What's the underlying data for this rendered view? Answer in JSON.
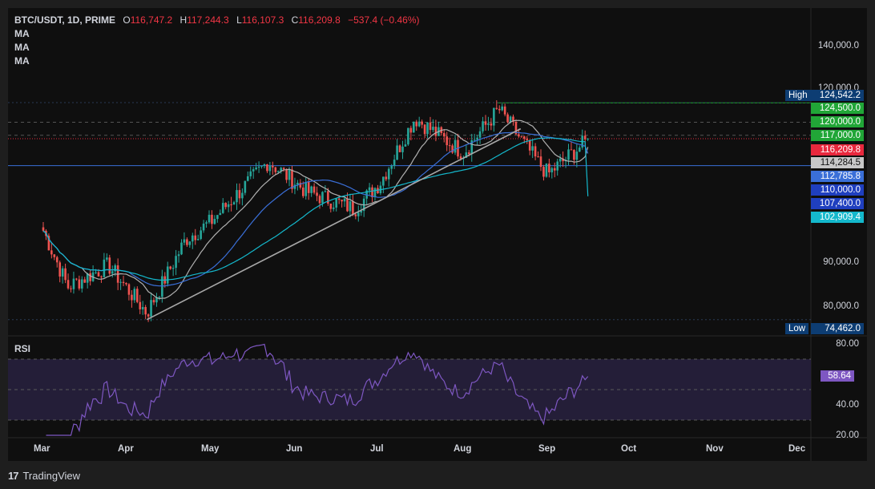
{
  "header": {
    "symbol": "BTC/USDT, 1D, PRIME",
    "o_label": "O",
    "o_value": "116,747.2",
    "h_label": "H",
    "h_value": "117,244.3",
    "l_label": "L",
    "l_value": "116,107.3",
    "c_label": "C",
    "c_value": "116,209.8",
    "change": "−537.4 (−0.46%)"
  },
  "indicators": [
    "MA",
    "MA",
    "MA"
  ],
  "rsi_label": "RSI",
  "price_axis_ticks": [
    "140,000.0",
    "120,000.0",
    "90,000.0",
    "80,000.0"
  ],
  "rsi_axis_ticks": [
    "80.00",
    "40.00",
    "20.00"
  ],
  "price_tags": [
    {
      "text": "124,542.2",
      "color": "#0d3d73",
      "label": "High"
    },
    {
      "text": "124,500.0",
      "color": "#21a637"
    },
    {
      "text": "120,000.0",
      "color": "#21a637"
    },
    {
      "text": "117,000.0",
      "color": "#21a637"
    },
    {
      "text": "116,209.8",
      "color": "#e8283d"
    },
    {
      "text": "114,284.5",
      "color": "#c8c8c8"
    },
    {
      "text": "112,785.8",
      "color": "#3a6fd8"
    },
    {
      "text": "110,000.0",
      "color": "#1f3fbf"
    },
    {
      "text": "107,400.0",
      "color": "#1f3fbf"
    },
    {
      "text": "102,909.4",
      "color": "#14b8cc"
    },
    {
      "text": "74,462.0",
      "color": "#0d3d73",
      "label": "Low"
    }
  ],
  "rsi_tag": {
    "text": "58.64",
    "color": "#7e57c2"
  },
  "months": [
    "Mar",
    "Apr",
    "May",
    "Jun",
    "Jul",
    "Aug",
    "Sep",
    "Oct",
    "Nov",
    "Dec"
  ],
  "footer": {
    "brand": "TradingView",
    "logo": "17"
  },
  "colors": {
    "up": "#26a69a",
    "down": "#ef5350",
    "ma_fast": "#b0b0b0",
    "ma_mid": "#3a6fd8",
    "ma_slow": "#14b8cc",
    "rsi": "#7e57c2"
  },
  "chart_data": {
    "type": "candlestick",
    "symbol": "BTC/USDT",
    "interval": "1D",
    "ylim": [
      72000,
      146000
    ],
    "last_close": 116209.8,
    "high": 124542.2,
    "low": 74462.0,
    "horizontal_levels": [
      124500.0,
      120000.0,
      117000.0,
      110000.0
    ],
    "trendline": {
      "from": {
        "date": "Apr 8",
        "price": 74462.0
      },
      "to": {
        "date": "Aug 22",
        "price": 118500.0
      }
    },
    "closes_approx": [
      {
        "date": "Mar 1",
        "close": 95000
      },
      {
        "date": "Mar 10",
        "close": 82000
      },
      {
        "date": "Mar 25",
        "close": 87000
      },
      {
        "date": "Apr 8",
        "close": 76000
      },
      {
        "date": "Apr 22",
        "close": 93000
      },
      {
        "date": "May 1",
        "close": 97000
      },
      {
        "date": "May 22",
        "close": 111000
      },
      {
        "date": "Jun 5",
        "close": 104000
      },
      {
        "date": "Jun 22",
        "close": 100000
      },
      {
        "date": "Jul 1",
        "close": 106000
      },
      {
        "date": "Jul 14",
        "close": 121000
      },
      {
        "date": "Aug 1",
        "close": 113000
      },
      {
        "date": "Aug 14",
        "close": 123000
      },
      {
        "date": "Aug 28",
        "close": 111000
      },
      {
        "date": "Sep 1",
        "close": 108000
      },
      {
        "date": "Sep 10",
        "close": 113000
      },
      {
        "date": "Sep 16",
        "close": 116209.8
      }
    ],
    "moving_averages": [
      {
        "last": 114284.5
      },
      {
        "last": 112785.8
      },
      {
        "last": 102909.4
      }
    ],
    "rsi": {
      "last": 58.64,
      "ylim": [
        20,
        80
      ],
      "bands": [
        30,
        50,
        70
      ]
    }
  }
}
